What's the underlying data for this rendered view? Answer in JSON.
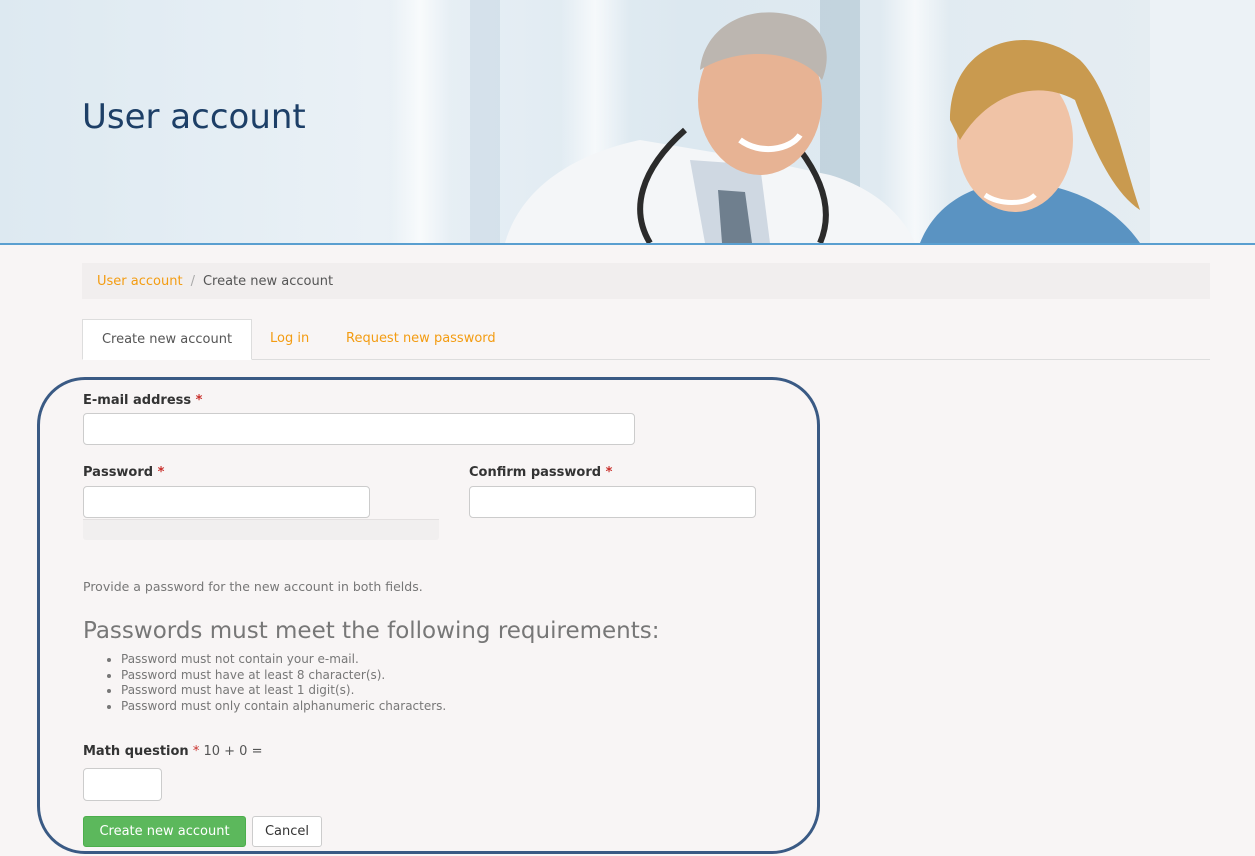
{
  "banner": {
    "title": "User account"
  },
  "breadcrumb": {
    "items": [
      "User account",
      "Create new account"
    ],
    "separator": "/"
  },
  "tabs": [
    {
      "label": "Create new account",
      "active": true
    },
    {
      "label": "Log in",
      "active": false
    },
    {
      "label": "Request new password",
      "active": false
    }
  ],
  "form": {
    "email_label": "E-mail address",
    "email_value": "",
    "password_label": "Password",
    "password_value": "",
    "confirm_label": "Confirm password",
    "confirm_value": "",
    "required_mark": "*",
    "help_text": "Provide a password for the new account in both fields.",
    "requirements_heading": "Passwords must meet the following requirements:",
    "requirements": [
      "Password must not contain your e-mail.",
      "Password must have at least 8 character(s).",
      "Password must have at least 1 digit(s).",
      "Password must only contain alphanumeric characters."
    ],
    "math_label": "Math question",
    "math_question": "10 + 0 =",
    "math_value": "",
    "submit_label": "Create new account",
    "cancel_label": "Cancel"
  },
  "colors": {
    "accent_link": "#f39c12",
    "primary_button": "#5cb85c",
    "required": "#c9302c",
    "frame": "#3a5a84",
    "title": "#1d3f67"
  }
}
